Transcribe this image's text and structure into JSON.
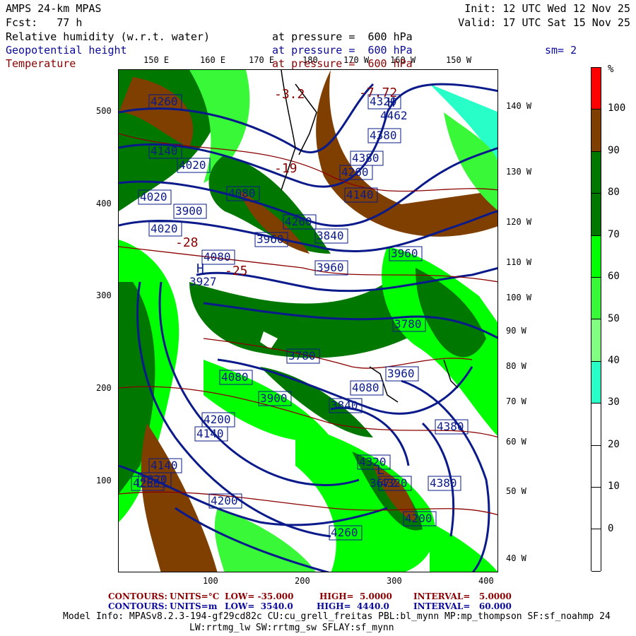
{
  "header": {
    "model": "AMPS 24-km MPAS",
    "fcst": "Fcst:   77 h",
    "init": "Init: 12 UTC Wed 12 Nov 25",
    "valid": "Valid: 17 UTC Sat 15 Nov 25",
    "fields": [
      {
        "name": "Relative humidity (w.r.t. water)",
        "level": "at pressure =  600 hPa"
      },
      {
        "name": "Geopotential height",
        "level": "at pressure =  600 hPa",
        "extra": "sm= 2"
      },
      {
        "name": "Temperature",
        "level": "at pressure =  600 hPa"
      }
    ]
  },
  "axes": {
    "top_lon": [
      "150 E",
      "160 E",
      "170 E",
      "180",
      "170 W",
      "160 W",
      "150 W"
    ],
    "right_lon": [
      "140 W",
      "130 W",
      "120 W",
      "110 W",
      "100 W",
      "90 W",
      "80 W",
      "70 W",
      "60 W",
      "50 W",
      "40 W"
    ],
    "left_y": [
      "500",
      "400",
      "300",
      "200",
      "100"
    ],
    "bottom_x": [
      "100",
      "200",
      "300",
      "400"
    ]
  },
  "colorbar": {
    "unit": "%",
    "labels": [
      "100",
      "90",
      "80",
      "70",
      "60",
      "50",
      "40",
      "30",
      "20",
      "10",
      "0"
    ],
    "colors": [
      "#ff0000",
      "#7f3f00",
      "#007800",
      "#007800",
      "#00ff00",
      "#38f838",
      "#80ff80",
      "#28ffc8",
      "#ffffff",
      "#ffffff",
      "#ffffff",
      "#ffffff"
    ]
  },
  "height_labels": [
    "4260",
    "4140",
    "4020",
    "4020",
    "4020",
    "4080",
    "3900",
    "3960",
    "4080",
    "4260",
    "4380",
    "4320",
    "4380",
    "4260",
    "4140",
    "3960",
    "3840",
    "3960",
    "3780",
    "3960",
    "4200",
    "4080",
    "3840",
    "3900",
    "3780",
    "4080",
    "4020",
    "4140",
    "4140",
    "4200",
    "4260",
    "4320",
    "4380",
    "4380",
    "4320",
    "4260",
    "4200"
  ],
  "extrema": [
    {
      "type": "H",
      "value": "4462"
    },
    {
      "type": "H",
      "value": "3927"
    },
    {
      "type": "L",
      "value": "3672"
    }
  ],
  "temp_labels": [
    "-3.2",
    "-7.72",
    "-28",
    "-25",
    "-19"
  ],
  "footer": {
    "temp_contours": {
      "label": "CONTOURS:",
      "units": "UNITS=°C",
      "low": "LOW= -35.000",
      "high": "HIGH=  5.0000",
      "interval": "INTERVAL=   5.0000"
    },
    "hgt_contours": {
      "label": "CONTOURS:",
      "units": "UNITS=m",
      "low": "LOW=  3540.0",
      "high": "HIGH=  4440.0",
      "interval": "INTERVAL=   60.000"
    },
    "model_info": "Model Info: MPASv8.2.3-194-gf29cd82c CU:cu_grell_freitas PBL:bl_mynn MP:mp_thompson SF:sf_noahmp 24",
    "model_info2": "LW:rrtmg_lw SW:rrtmg_sw SFLAY:sf_mynn"
  }
}
